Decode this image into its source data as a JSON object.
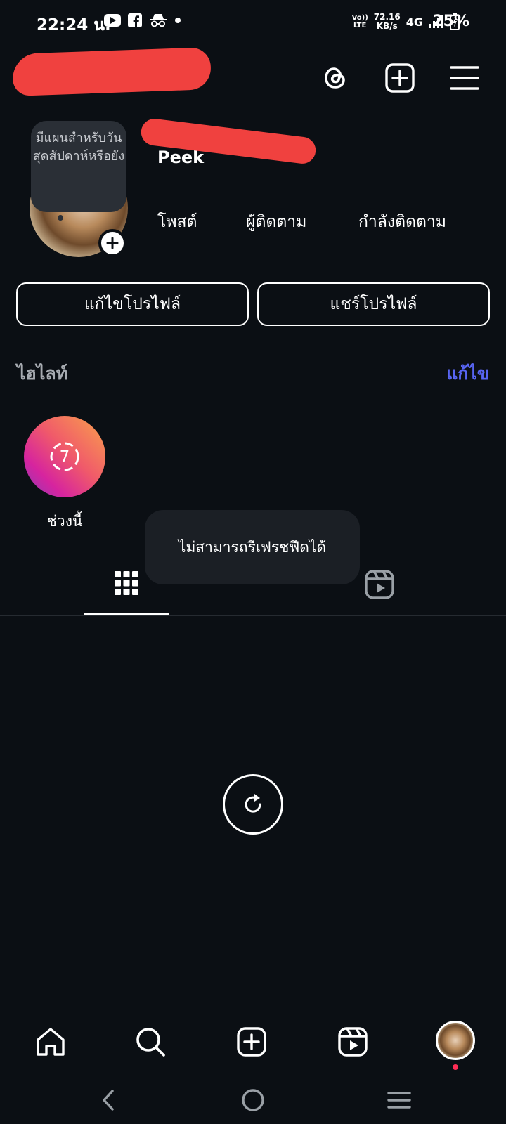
{
  "status_bar": {
    "time": "22:24 น.",
    "volte_top": "Vo))",
    "volte_bottom": "LTE",
    "speed_value": "72.16",
    "speed_unit": "KB/s",
    "network": "4G",
    "battery": "25%"
  },
  "profile": {
    "display_name": "Peek",
    "note": "มีแผนสำหรับวันสุดสัปดาห์หรือยัง",
    "stats": {
      "posts_label": "โพสต์",
      "followers_label": "ผู้ติดตาม",
      "following_label": "กำลังติดตาม"
    },
    "edit_profile_label": "แก้ไขโปรไฟล์",
    "share_profile_label": "แชร์โปรไฟล์"
  },
  "highlights": {
    "title": "ไฮไลท์",
    "edit_label": "แก้ไข",
    "items": [
      {
        "label": "ช่วงนี้",
        "badge": "7"
      }
    ]
  },
  "toast": {
    "message": "ไม่สามารถรีเฟรชฟีดได้"
  },
  "colors": {
    "background": "#0b0f14",
    "accent_link": "#5865f2",
    "redaction": "#f0413f",
    "notification_dot": "#ff2d55"
  },
  "icons": {
    "status_left": [
      "youtube-icon",
      "facebook-icon",
      "incognito-icon",
      "dot-icon"
    ],
    "header": [
      "threads-icon",
      "add-post-icon",
      "menu-icon"
    ],
    "tabs": [
      "grid-icon",
      "reels-icon"
    ],
    "bottom_nav": [
      "home-icon",
      "search-icon",
      "create-icon",
      "reels-icon",
      "profile-avatar"
    ],
    "system_nav": [
      "back-icon",
      "home-circle-icon",
      "recents-icon"
    ]
  }
}
